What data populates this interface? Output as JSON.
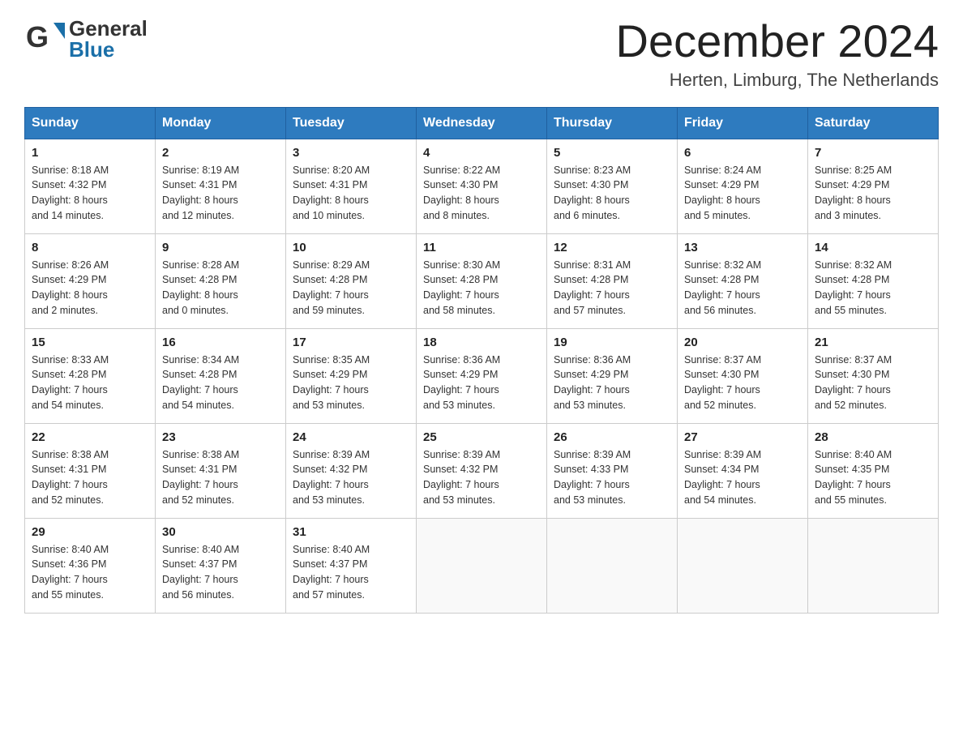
{
  "header": {
    "logo_general": "General",
    "logo_blue": "Blue",
    "month_title": "December 2024",
    "location": "Herten, Limburg, The Netherlands"
  },
  "weekdays": [
    "Sunday",
    "Monday",
    "Tuesday",
    "Wednesday",
    "Thursday",
    "Friday",
    "Saturday"
  ],
  "weeks": [
    [
      {
        "day": "1",
        "sunrise": "Sunrise: 8:18 AM",
        "sunset": "Sunset: 4:32 PM",
        "daylight": "Daylight: 8 hours",
        "daylight2": "and 14 minutes."
      },
      {
        "day": "2",
        "sunrise": "Sunrise: 8:19 AM",
        "sunset": "Sunset: 4:31 PM",
        "daylight": "Daylight: 8 hours",
        "daylight2": "and 12 minutes."
      },
      {
        "day": "3",
        "sunrise": "Sunrise: 8:20 AM",
        "sunset": "Sunset: 4:31 PM",
        "daylight": "Daylight: 8 hours",
        "daylight2": "and 10 minutes."
      },
      {
        "day": "4",
        "sunrise": "Sunrise: 8:22 AM",
        "sunset": "Sunset: 4:30 PM",
        "daylight": "Daylight: 8 hours",
        "daylight2": "and 8 minutes."
      },
      {
        "day": "5",
        "sunrise": "Sunrise: 8:23 AM",
        "sunset": "Sunset: 4:30 PM",
        "daylight": "Daylight: 8 hours",
        "daylight2": "and 6 minutes."
      },
      {
        "day": "6",
        "sunrise": "Sunrise: 8:24 AM",
        "sunset": "Sunset: 4:29 PM",
        "daylight": "Daylight: 8 hours",
        "daylight2": "and 5 minutes."
      },
      {
        "day": "7",
        "sunrise": "Sunrise: 8:25 AM",
        "sunset": "Sunset: 4:29 PM",
        "daylight": "Daylight: 8 hours",
        "daylight2": "and 3 minutes."
      }
    ],
    [
      {
        "day": "8",
        "sunrise": "Sunrise: 8:26 AM",
        "sunset": "Sunset: 4:29 PM",
        "daylight": "Daylight: 8 hours",
        "daylight2": "and 2 minutes."
      },
      {
        "day": "9",
        "sunrise": "Sunrise: 8:28 AM",
        "sunset": "Sunset: 4:28 PM",
        "daylight": "Daylight: 8 hours",
        "daylight2": "and 0 minutes."
      },
      {
        "day": "10",
        "sunrise": "Sunrise: 8:29 AM",
        "sunset": "Sunset: 4:28 PM",
        "daylight": "Daylight: 7 hours",
        "daylight2": "and 59 minutes."
      },
      {
        "day": "11",
        "sunrise": "Sunrise: 8:30 AM",
        "sunset": "Sunset: 4:28 PM",
        "daylight": "Daylight: 7 hours",
        "daylight2": "and 58 minutes."
      },
      {
        "day": "12",
        "sunrise": "Sunrise: 8:31 AM",
        "sunset": "Sunset: 4:28 PM",
        "daylight": "Daylight: 7 hours",
        "daylight2": "and 57 minutes."
      },
      {
        "day": "13",
        "sunrise": "Sunrise: 8:32 AM",
        "sunset": "Sunset: 4:28 PM",
        "daylight": "Daylight: 7 hours",
        "daylight2": "and 56 minutes."
      },
      {
        "day": "14",
        "sunrise": "Sunrise: 8:32 AM",
        "sunset": "Sunset: 4:28 PM",
        "daylight": "Daylight: 7 hours",
        "daylight2": "and 55 minutes."
      }
    ],
    [
      {
        "day": "15",
        "sunrise": "Sunrise: 8:33 AM",
        "sunset": "Sunset: 4:28 PM",
        "daylight": "Daylight: 7 hours",
        "daylight2": "and 54 minutes."
      },
      {
        "day": "16",
        "sunrise": "Sunrise: 8:34 AM",
        "sunset": "Sunset: 4:28 PM",
        "daylight": "Daylight: 7 hours",
        "daylight2": "and 54 minutes."
      },
      {
        "day": "17",
        "sunrise": "Sunrise: 8:35 AM",
        "sunset": "Sunset: 4:29 PM",
        "daylight": "Daylight: 7 hours",
        "daylight2": "and 53 minutes."
      },
      {
        "day": "18",
        "sunrise": "Sunrise: 8:36 AM",
        "sunset": "Sunset: 4:29 PM",
        "daylight": "Daylight: 7 hours",
        "daylight2": "and 53 minutes."
      },
      {
        "day": "19",
        "sunrise": "Sunrise: 8:36 AM",
        "sunset": "Sunset: 4:29 PM",
        "daylight": "Daylight: 7 hours",
        "daylight2": "and 53 minutes."
      },
      {
        "day": "20",
        "sunrise": "Sunrise: 8:37 AM",
        "sunset": "Sunset: 4:30 PM",
        "daylight": "Daylight: 7 hours",
        "daylight2": "and 52 minutes."
      },
      {
        "day": "21",
        "sunrise": "Sunrise: 8:37 AM",
        "sunset": "Sunset: 4:30 PM",
        "daylight": "Daylight: 7 hours",
        "daylight2": "and 52 minutes."
      }
    ],
    [
      {
        "day": "22",
        "sunrise": "Sunrise: 8:38 AM",
        "sunset": "Sunset: 4:31 PM",
        "daylight": "Daylight: 7 hours",
        "daylight2": "and 52 minutes."
      },
      {
        "day": "23",
        "sunrise": "Sunrise: 8:38 AM",
        "sunset": "Sunset: 4:31 PM",
        "daylight": "Daylight: 7 hours",
        "daylight2": "and 52 minutes."
      },
      {
        "day": "24",
        "sunrise": "Sunrise: 8:39 AM",
        "sunset": "Sunset: 4:32 PM",
        "daylight": "Daylight: 7 hours",
        "daylight2": "and 53 minutes."
      },
      {
        "day": "25",
        "sunrise": "Sunrise: 8:39 AM",
        "sunset": "Sunset: 4:32 PM",
        "daylight": "Daylight: 7 hours",
        "daylight2": "and 53 minutes."
      },
      {
        "day": "26",
        "sunrise": "Sunrise: 8:39 AM",
        "sunset": "Sunset: 4:33 PM",
        "daylight": "Daylight: 7 hours",
        "daylight2": "and 53 minutes."
      },
      {
        "day": "27",
        "sunrise": "Sunrise: 8:39 AM",
        "sunset": "Sunset: 4:34 PM",
        "daylight": "Daylight: 7 hours",
        "daylight2": "and 54 minutes."
      },
      {
        "day": "28",
        "sunrise": "Sunrise: 8:40 AM",
        "sunset": "Sunset: 4:35 PM",
        "daylight": "Daylight: 7 hours",
        "daylight2": "and 55 minutes."
      }
    ],
    [
      {
        "day": "29",
        "sunrise": "Sunrise: 8:40 AM",
        "sunset": "Sunset: 4:36 PM",
        "daylight": "Daylight: 7 hours",
        "daylight2": "and 55 minutes."
      },
      {
        "day": "30",
        "sunrise": "Sunrise: 8:40 AM",
        "sunset": "Sunset: 4:37 PM",
        "daylight": "Daylight: 7 hours",
        "daylight2": "and 56 minutes."
      },
      {
        "day": "31",
        "sunrise": "Sunrise: 8:40 AM",
        "sunset": "Sunset: 4:37 PM",
        "daylight": "Daylight: 7 hours",
        "daylight2": "and 57 minutes."
      },
      {
        "day": "",
        "sunrise": "",
        "sunset": "",
        "daylight": "",
        "daylight2": ""
      },
      {
        "day": "",
        "sunrise": "",
        "sunset": "",
        "daylight": "",
        "daylight2": ""
      },
      {
        "day": "",
        "sunrise": "",
        "sunset": "",
        "daylight": "",
        "daylight2": ""
      },
      {
        "day": "",
        "sunrise": "",
        "sunset": "",
        "daylight": "",
        "daylight2": ""
      }
    ]
  ]
}
